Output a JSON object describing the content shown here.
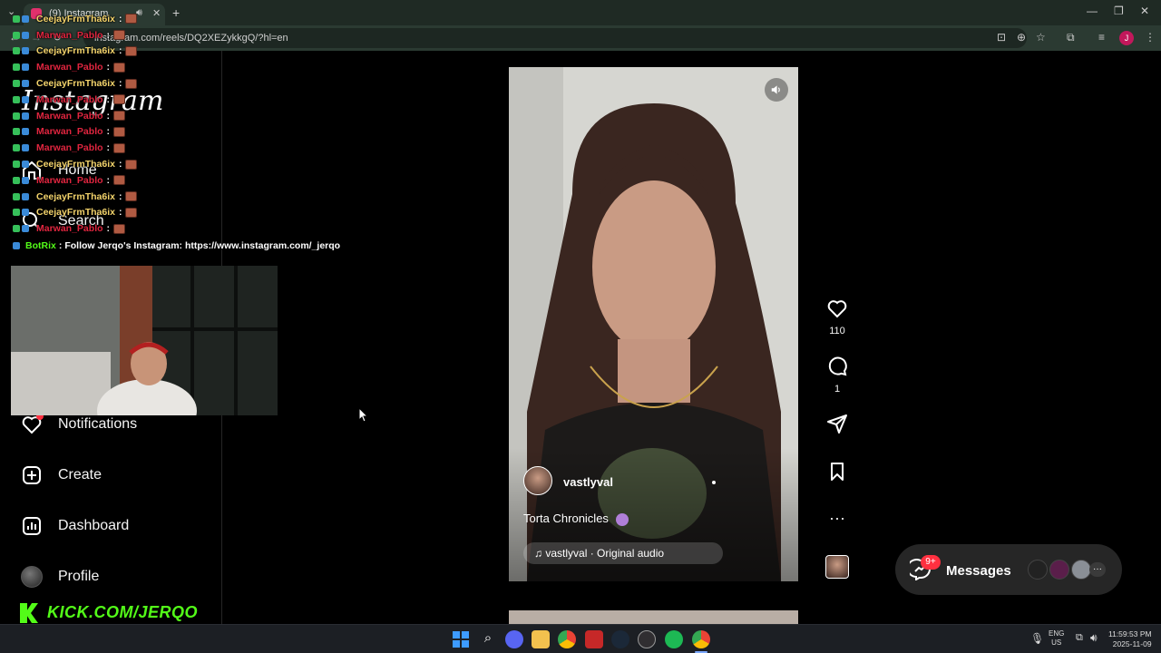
{
  "browser": {
    "tab_title": "(9) Instagram",
    "url": "instagram.com/reels/DQ2XEZykkgQ/?hl=en",
    "profile_initial": "J"
  },
  "sidebar": {
    "logo": "Instagram",
    "items": [
      {
        "label": "Home"
      },
      {
        "label": "Search"
      },
      {
        "label": "Notifications"
      },
      {
        "label": "Create"
      },
      {
        "label": "Dashboard"
      },
      {
        "label": "Profile"
      }
    ]
  },
  "chat": {
    "lines": [
      {
        "user": "CeejayFrmTha6ix",
        "color": "#f3d36b"
      },
      {
        "user": "Marwan_Pablo",
        "color": "#e0253f"
      },
      {
        "user": "CeejayFrmTha6ix",
        "color": "#f3d36b"
      },
      {
        "user": "Marwan_Pablo",
        "color": "#e0253f"
      },
      {
        "user": "CeejayFrmTha6ix",
        "color": "#f3d36b"
      },
      {
        "user": "Marwan_Pablo",
        "color": "#e0253f"
      },
      {
        "user": "Marwan_Pablo",
        "color": "#e0253f"
      },
      {
        "user": "Marwan_Pablo",
        "color": "#e0253f"
      },
      {
        "user": "Marwan_Pablo",
        "color": "#e0253f"
      },
      {
        "user": "CeejayFrmTha6ix",
        "color": "#f3d36b"
      },
      {
        "user": "Marwan_Pablo",
        "color": "#e0253f"
      },
      {
        "user": "CeejayFrmTha6ix",
        "color": "#f3d36b"
      },
      {
        "user": "CeejayFrmTha6ix",
        "color": "#f3d36b"
      },
      {
        "user": "Marwan_Pablo",
        "color": "#e0253f"
      }
    ],
    "bot_user": "BotRix",
    "bot_message": "Follow Jerqo's Instagram: https://www.instagram.com/_jerqo",
    "separator": ":"
  },
  "reel": {
    "username": "vastlyval",
    "caption": "Torta Chronicles",
    "audio": "vastlyval · Original audio",
    "likes": "110",
    "comments": "1"
  },
  "messages": {
    "label": "Messages",
    "badge": "9+"
  },
  "stream": {
    "kick_url": "KICK.COM/JERQO"
  },
  "taskbar": {
    "lang_line1": "ENG",
    "lang_line2": "US",
    "time": "11:59:53 PM",
    "date": "2025-11-09"
  },
  "colors": {
    "kick_green": "#53fc18",
    "instagram_badge": "#ff3040",
    "accent_blue": "#3d7eff"
  }
}
